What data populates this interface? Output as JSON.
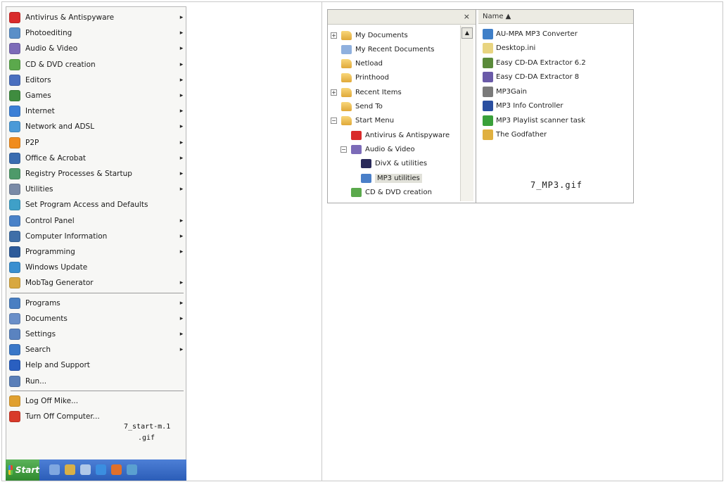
{
  "start_menu": {
    "items": [
      {
        "label": "Antivirus & Antispyware",
        "icon": "antivirus-icon",
        "color": "#d92b2b",
        "submenu": true
      },
      {
        "label": "Photoediting",
        "icon": "photoediting-icon",
        "color": "#5a8fc8",
        "submenu": true
      },
      {
        "label": "Audio & Video",
        "icon": "audio-video-icon",
        "color": "#7c6bb8",
        "submenu": true
      },
      {
        "label": "CD & DVD creation",
        "icon": "cd-dvd-icon",
        "color": "#5ba94c",
        "submenu": true
      },
      {
        "label": "Editors",
        "icon": "editors-icon",
        "color": "#4a6fbf",
        "submenu": true
      },
      {
        "label": "Games",
        "icon": "games-icon",
        "color": "#3f8c3f",
        "submenu": true
      },
      {
        "label": "Internet",
        "icon": "internet-icon",
        "color": "#3b7fd6",
        "submenu": true
      },
      {
        "label": "Network and ADSL",
        "icon": "network-icon",
        "color": "#4a9ad8",
        "submenu": true
      },
      {
        "label": "P2P",
        "icon": "p2p-icon",
        "color": "#f08c1e",
        "submenu": true
      },
      {
        "label": "Office & Acrobat",
        "icon": "office-icon",
        "color": "#3a6cb0",
        "submenu": true
      },
      {
        "label": "Registry Processes & Startup",
        "icon": "registry-icon",
        "color": "#4e9a6a",
        "submenu": true
      },
      {
        "label": "Utilities",
        "icon": "utilities-icon",
        "color": "#7a8aa6",
        "submenu": true
      },
      {
        "label": "Set Program Access and Defaults",
        "icon": "program-access-icon",
        "color": "#3fa0c8",
        "submenu": false
      },
      {
        "label": "Control Panel",
        "icon": "control-panel-icon",
        "color": "#4a82c8",
        "submenu": true
      },
      {
        "label": "Computer Information",
        "icon": "computer-info-icon",
        "color": "#3f6fa8",
        "submenu": true
      },
      {
        "label": "Programming",
        "icon": "programming-icon",
        "color": "#2d5b9a",
        "submenu": true
      },
      {
        "label": "Windows Update",
        "icon": "windows-update-icon",
        "color": "#3a8fd0",
        "submenu": false
      },
      {
        "label": "MobTag Generator",
        "icon": "mobtag-icon",
        "color": "#d8a840",
        "submenu": true
      }
    ],
    "system_items": [
      {
        "label": "Programs",
        "icon": "programs-icon",
        "color": "#4a7fc2",
        "submenu": true
      },
      {
        "label": "Documents",
        "icon": "documents-icon",
        "color": "#6a8fc8",
        "submenu": true
      },
      {
        "label": "Settings",
        "icon": "settings-icon",
        "color": "#5a83c0",
        "submenu": true
      },
      {
        "label": "Search",
        "icon": "search-icon",
        "color": "#3a78c8",
        "submenu": true
      },
      {
        "label": "Help and Support",
        "icon": "help-icon",
        "color": "#2a5fc0",
        "submenu": false
      },
      {
        "label": "Run...",
        "icon": "run-icon",
        "color": "#5a7fb8",
        "submenu": false
      }
    ],
    "session_items": [
      {
        "label": "Log Off Mike...",
        "icon": "log-off-icon",
        "color": "#e0a030"
      },
      {
        "label": "Turn Off Computer...",
        "icon": "turn-off-icon",
        "color": "#d83a2a"
      }
    ],
    "overlay_caption_line1": "7_start-m.1",
    "overlay_caption_line2": ".gif",
    "start_label": "Start"
  },
  "explorer": {
    "folders_close": "×",
    "name_column": "Name ▲",
    "tree": [
      {
        "label": "My Documents",
        "expander": "+",
        "indent": 0,
        "icon": "folder-icon"
      },
      {
        "label": "My Recent Documents",
        "expander": "",
        "indent": 0,
        "icon": "recent-docs-icon"
      },
      {
        "label": "Netload",
        "expander": "",
        "indent": 0,
        "icon": "folder-icon"
      },
      {
        "label": "Printhood",
        "expander": "",
        "indent": 0,
        "icon": "folder-icon"
      },
      {
        "label": "Recent Items",
        "expander": "+",
        "indent": 0,
        "icon": "folder-icon"
      },
      {
        "label": "Send To",
        "expander": "",
        "indent": 0,
        "icon": "folder-icon"
      },
      {
        "label": "Start Menu",
        "expander": "−",
        "indent": 0,
        "icon": "folder-icon"
      },
      {
        "label": "Antivirus & Antispyware",
        "expander": "",
        "indent": 1,
        "icon": "antivirus-icon"
      },
      {
        "label": "Audio & Video",
        "expander": "−",
        "indent": 1,
        "icon": "audio-video-icon"
      },
      {
        "label": "DivX & utilities",
        "expander": "",
        "indent": 2,
        "icon": "divx-icon"
      },
      {
        "label": "MP3 utilities",
        "expander": "",
        "indent": 2,
        "icon": "mp3-icon",
        "selected": true
      },
      {
        "label": "CD & DVD creation",
        "expander": "",
        "indent": 1,
        "icon": "cd-dvd-icon"
      }
    ],
    "files": [
      {
        "label": "AU-MPA MP3 Converter",
        "icon": "converter-icon",
        "color": "#3f7fc8"
      },
      {
        "label": "Desktop.ini",
        "icon": "ini-file-icon",
        "color": "#e8d480"
      },
      {
        "label": "Easy CD-DA Extractor 6.2",
        "icon": "cd-extractor-icon",
        "color": "#5a8a3a"
      },
      {
        "label": "Easy CD-DA Extractor 8",
        "icon": "cd-extractor-icon",
        "color": "#6a5aa8"
      },
      {
        "label": "MP3Gain",
        "icon": "mp3gain-icon",
        "color": "#7a7a7a"
      },
      {
        "label": "MP3 Info Controller",
        "icon": "mp3info-icon",
        "color": "#2a4fa0"
      },
      {
        "label": "MP3 Playlist scanner task",
        "icon": "playlist-icon",
        "color": "#3aa03a"
      },
      {
        "label": "The Godfather",
        "icon": "godfather-icon",
        "color": "#e0b040"
      }
    ],
    "caption": "7_MP3.gif"
  }
}
